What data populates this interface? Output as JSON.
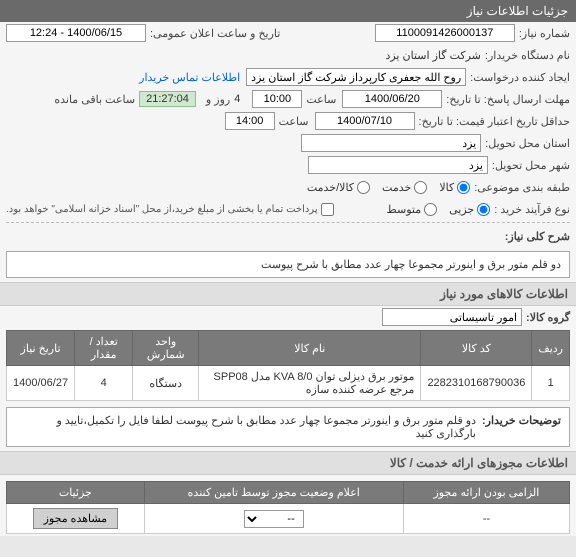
{
  "header": {
    "title": "جزئیات اطلاعات نیاز"
  },
  "fields": {
    "need_no_label": "شماره نیاز:",
    "need_no": "1100091426000137",
    "public_date_label": "تاریخ و ساعت اعلان عمومی:",
    "public_date": "1400/06/15 - 12:24",
    "buyer_org_label": "نام دستگاه خریدار:",
    "buyer_org": "شرکت گاز استان یزد",
    "requester_label": "ایجاد کننده درخواست:",
    "requester": "روح الله جعفری کارپرداز شرکت گاز استان یزد",
    "contact_link": "اطلاعات تماس خریدار",
    "reply_deadline_label": "مهلت ارسال پاسخ: تا تاریخ:",
    "reply_deadline_date": "1400/06/20",
    "time_label": "ساعت",
    "reply_deadline_time": "10:00",
    "days_label": "روز و",
    "days_value": "4",
    "remaining_time": "21:27:04",
    "remaining_label": "ساعت باقی مانده",
    "validity_label": "حداقل تاریخ اعتبار قیمت: تا تاریخ:",
    "validity_date": "1400/07/10",
    "validity_time": "14:00",
    "location_label": "استان محل تحویل:",
    "location": "یزد",
    "city_label": "شهر محل تحویل:",
    "city": "یزد",
    "category_label": "طبقه بندی موضوعی:",
    "cat_goods": "کالا",
    "cat_service": "خدمت",
    "cat_both": "کالا/خدمت",
    "process_label": "نوع فرآیند خرید :",
    "proc_partial": "جزیی",
    "proc_medium": "متوسط",
    "payment_note": "پرداخت تمام یا بخشی از مبلغ خرید،از محل \"اسناد خزانه اسلامی\" خواهد بود.",
    "desc_label": "شرح کلی نیاز:",
    "desc_text": "دو قلم متور برق و اینورتر مجموعا چهار عدد مطابق با شرح پیوست",
    "goods_section": "اطلاعات کالاهای مورد نیاز",
    "goods_group_label": "گروه کالا:",
    "goods_group": "امور تاسیساتی",
    "buyer_note_label": "توضیحات خریدار:",
    "buyer_note": "دو قلم متور برق و اینورتر مجموعا چهار عدد مطابق با شرح پیوست لطفا فایل را تکمیل،تایید و بارگذاری کنید",
    "permits_section": "اطلاعات مجوزهای ارائه خدمت / کالا"
  },
  "table": {
    "headers": {
      "row": "ردیف",
      "code": "کد کالا",
      "name": "نام کالا",
      "unit": "واحد شمارش",
      "qty": "تعداد / مقدار",
      "date": "تاریخ نیاز"
    },
    "rows": [
      {
        "row": "1",
        "code": "2282310168790036",
        "name": "موتور برق دیزلی توان KVA 8/0 مدل SPP08 مرجع عرضه کننده سازه",
        "unit": "دستگاه",
        "qty": "4",
        "date": "1400/06/27"
      }
    ]
  },
  "permits_table": {
    "headers": {
      "mandatory": "الزامی بودن ارائه مجوز",
      "status": "اعلام وضعیت مجوز توسط تامین کننده",
      "details": "جزئیات"
    },
    "rows": [
      {
        "mandatory": "--",
        "details_btn": "مشاهده مجوز"
      }
    ],
    "select_placeholder": "--"
  }
}
